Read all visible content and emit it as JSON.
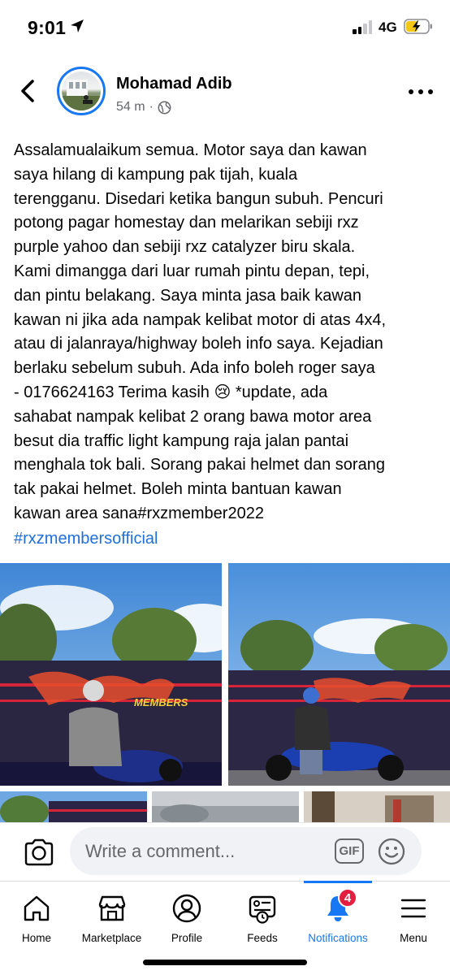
{
  "status_bar": {
    "time": "9:01",
    "network": "4G"
  },
  "post": {
    "author": "Mohamad Adib",
    "time_ago": "54 m",
    "separator": "·",
    "text": "Assalamualaikum semua. Motor saya dan kawan\nsaya hilang di kampung pak tijah, kuala\nterengganu. Disedari ketika bangun subuh. Pencuri\npotong pagar homestay dan melarikan sebiji rxz\npurple yahoo dan sebiji rxz catalyzer biru skala.\nKami dimangga dari luar rumah pintu depan, tepi,\ndan pintu belakang. Saya minta jasa baik kawan\nkawan ni jika ada nampak kelibat motor di atas 4x4,\natau di jalanraya/highway boleh info saya. Kejadian\nberlaku sebelum subuh. Ada info boleh roger saya\n- 0176624163  Terima kasih 😢 *update, ada\nsahabat nampak kelibat 2 orang bawa motor area\nbesut dia traffic light kampung raja jalan pantai\nmenghala tok bali. Sorang pakai helmet dan sorang\ntak pakai helmet. Boleh minta bantuan kawan\nkawan area sana#rxzmember2022",
    "hashtag": "#rxzmembersofficial",
    "banner_text": "MEMBERS"
  },
  "comment_bar": {
    "placeholder": "Write a comment...",
    "gif_label": "GIF"
  },
  "tabs": [
    {
      "label": "Home",
      "icon": "home-icon"
    },
    {
      "label": "Marketplace",
      "icon": "marketplace-icon"
    },
    {
      "label": "Profile",
      "icon": "profile-icon"
    },
    {
      "label": "Feeds",
      "icon": "feeds-icon"
    },
    {
      "label": "Notifications",
      "icon": "bell-icon",
      "active": true,
      "badge": "4"
    },
    {
      "label": "Menu",
      "icon": "menu-icon"
    }
  ],
  "colors": {
    "accent": "#1877f2",
    "badge": "#e41e3f",
    "hashtag": "#216fdb",
    "secondary_text": "#65676b"
  }
}
